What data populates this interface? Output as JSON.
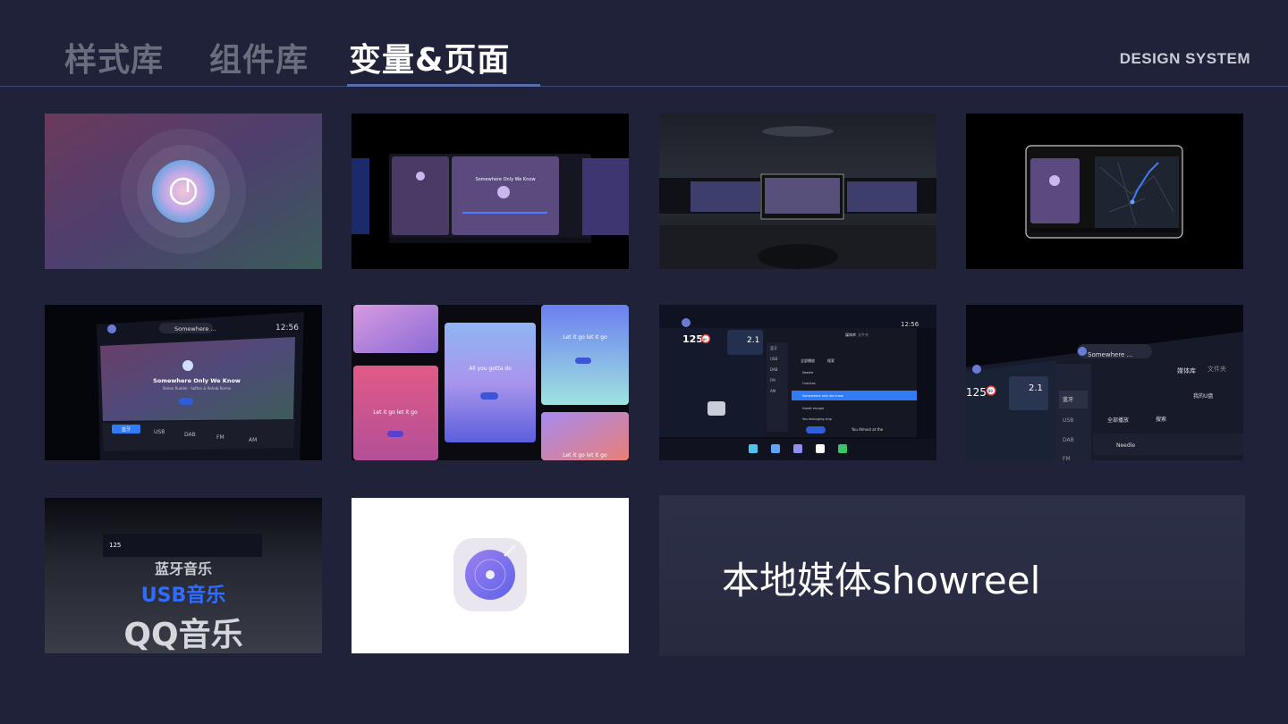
{
  "header": {
    "tabs": [
      {
        "label": "样式库",
        "active": false
      },
      {
        "label": "组件库",
        "active": false
      },
      {
        "label": "变量&页面",
        "active": true
      }
    ],
    "brand": "DESIGN SYSTEM"
  },
  "colors": {
    "background": "#1f2238",
    "accent": "#5a6fb0",
    "highlight_blue": "#2f7cf6"
  },
  "thumbs": {
    "t2": {
      "song": "Somewhere Only We Know"
    },
    "t5": {
      "song_short": "Somewhere ...",
      "song": "Somewhere Only We Know",
      "artist": "Simon Ruddel · Soften & Rehab Remix",
      "time": "12:56",
      "sources": [
        "蓝牙",
        "USB",
        "DAB",
        "FM",
        "AM"
      ]
    },
    "t6": {
      "lyric1": "Let it go let it go",
      "lyric2": "All you gotta do",
      "lyric3": "Let it go let it go",
      "lyric4": "Let it go let it go"
    },
    "t7": {
      "time": "12:56",
      "speed": "125",
      "limit": "80",
      "nav_dist": "2.1",
      "tab_media": "媒体库",
      "tab_file": "文件夹",
      "play_all": "全部播放",
      "search": "搜索",
      "menu": [
        "蓝牙",
        "USB",
        "DAB",
        "FM",
        "AM"
      ],
      "tracks": [
        "Needle",
        "Gravitas",
        "Somewhere only we know",
        "Sweet escape",
        "You belonging ship"
      ],
      "now_playing": "You Almost at the"
    },
    "t8": {
      "song_short": "Somewhere ...",
      "tab_media": "媒体库",
      "tab_file": "文件夹",
      "my_disk": "我的U盘",
      "play_all": "全部播放",
      "search": "搜索",
      "speed": "125",
      "limit": "80",
      "nav_dist": "2.1",
      "menu": [
        "蓝牙",
        "USB",
        "DAB",
        "FM"
      ],
      "track": "Needle"
    },
    "t9": {
      "line1": "蓝牙音乐",
      "line2": "USB音乐",
      "line3": "QQ音乐",
      "speed": "125"
    }
  },
  "showreel": {
    "label": "本地媒体showreel"
  }
}
